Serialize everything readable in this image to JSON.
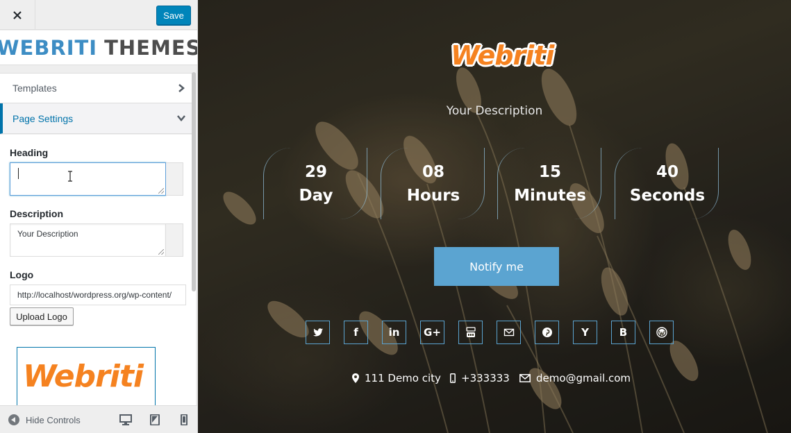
{
  "panel": {
    "close_label": "Close",
    "save_label": "Save",
    "brand_part1": "WEBRITI",
    "brand_part2": "THEMES",
    "nav": [
      {
        "label": "Templates"
      },
      {
        "label": "Page Settings"
      }
    ],
    "settings": {
      "heading_label": "Heading",
      "heading_value": "",
      "description_label": "Description",
      "description_value": "Your Description",
      "logo_label": "Logo",
      "logo_value": "http://localhost/wordpress.org/wp-content/",
      "upload_label": "Upload Logo",
      "logo_preview_text": "Webriti"
    },
    "footer": {
      "hide_controls_label": "Hide Controls",
      "devices": [
        "desktop-icon",
        "tablet-icon",
        "mobile-icon"
      ]
    }
  },
  "preview": {
    "logo_text": "Webriti",
    "description": "Your Description",
    "countdown": [
      {
        "value": "29",
        "unit": "Day"
      },
      {
        "value": "08",
        "unit": "Hours"
      },
      {
        "value": "15",
        "unit": "Minutes"
      },
      {
        "value": "40",
        "unit": "Seconds"
      }
    ],
    "notify_label": "Notify me",
    "social": [
      {
        "icon": "twitter-icon",
        "glyph": ""
      },
      {
        "icon": "facebook-icon",
        "glyph": "f"
      },
      {
        "icon": "linkedin-icon",
        "glyph": "in"
      },
      {
        "icon": "google-plus-icon",
        "glyph": "G+"
      },
      {
        "icon": "youtube-icon",
        "glyph": ""
      },
      {
        "icon": "email-icon",
        "glyph": ""
      },
      {
        "icon": "pinterest-icon",
        "glyph": ""
      },
      {
        "icon": "yahoo-icon",
        "glyph": "Y"
      },
      {
        "icon": "behance-icon",
        "glyph": "B"
      },
      {
        "icon": "wordpress-icon",
        "glyph": ""
      }
    ],
    "contact": {
      "address": "111 Demo city",
      "phone": "+333333",
      "email": "demo@gmail.com"
    }
  },
  "colors": {
    "accent": "#0085ba",
    "brand_blue": "#3d8dc4",
    "logo_orange": "#f58220",
    "notify_bg": "#5ba4d1"
  }
}
